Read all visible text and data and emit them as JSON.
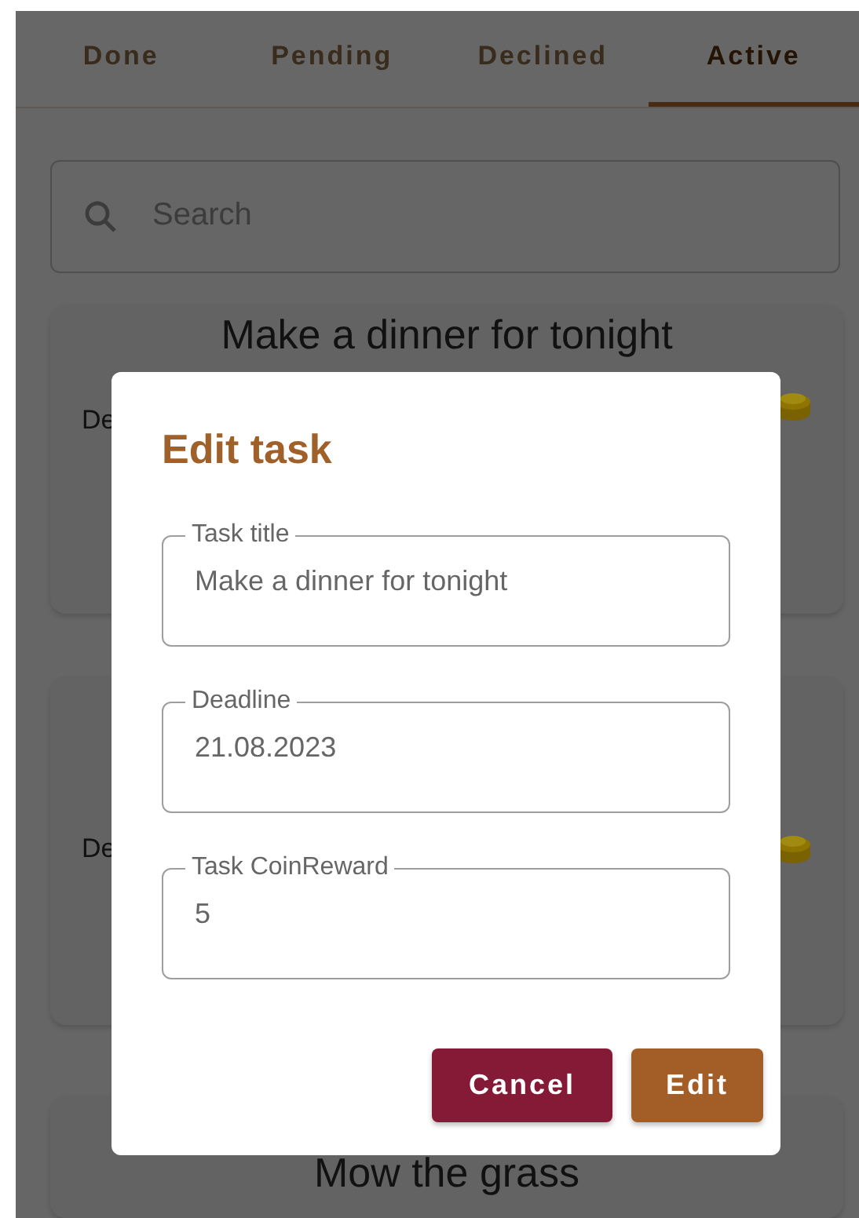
{
  "tabs": [
    {
      "label": "Done",
      "selected": false
    },
    {
      "label": "Pending",
      "selected": false
    },
    {
      "label": "Declined",
      "selected": false
    },
    {
      "label": "Active",
      "selected": true
    }
  ],
  "search": {
    "placeholder": "Search"
  },
  "tasks": [
    {
      "title": "Make a dinner for tonight",
      "deadline_label": "De"
    },
    {
      "deadline_label": "De"
    },
    {
      "title": "Mow the grass"
    }
  ],
  "dialog": {
    "title": "Edit task",
    "fields": [
      {
        "label": "Task title",
        "value": "Make a dinner for tonight"
      },
      {
        "label": "Deadline",
        "value": "21.08.2023"
      },
      {
        "label": "Task CoinReward",
        "value": "5"
      }
    ],
    "buttons": [
      {
        "label": "Cancel",
        "kind": "cancel"
      },
      {
        "label": "Edit",
        "kind": "confirm"
      }
    ]
  }
}
